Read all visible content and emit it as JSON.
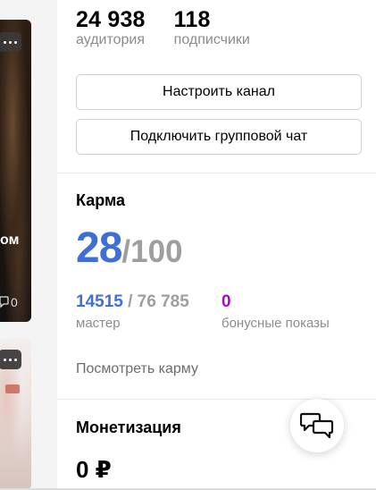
{
  "feed": {
    "card1_title": "ом",
    "card1_comments": "0"
  },
  "stats": {
    "audience_value": "24 938",
    "audience_label": "аудитория",
    "subscribers_value": "118",
    "subscribers_label": "подписчики"
  },
  "buttons": {
    "setup_channel": "Настроить канал",
    "connect_chat": "Подключить групповой чат"
  },
  "karma": {
    "title": "Карма",
    "score": "28",
    "max": "/100",
    "progress_current": "14515",
    "progress_total": " / 76 785",
    "level_label": "мастер",
    "bonus_value": "0",
    "bonus_label": "бонусные показы",
    "view_link": "Посмотреть карму"
  },
  "monetization": {
    "title": "Монетизация",
    "amount": "0 ₽"
  },
  "colors": {
    "accent_blue": "#3f6fd6",
    "bonus_purple": "#b200d9",
    "muted": "#8c8c8c"
  },
  "icons": {
    "more": "more-dots-icon",
    "comment": "comment-icon",
    "chat": "chat-bubbles-icon"
  }
}
